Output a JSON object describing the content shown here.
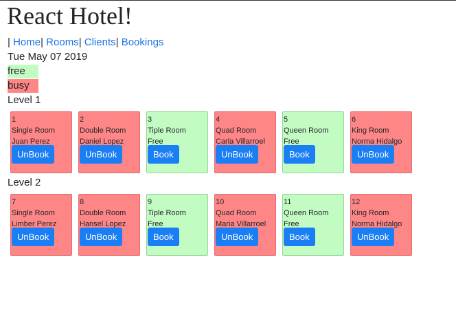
{
  "app": {
    "title": "React Hotel!"
  },
  "nav": {
    "leading_sep": "|",
    "items": [
      {
        "label": "Home",
        "sep": "|"
      },
      {
        "label": "Rooms",
        "sep": "|"
      },
      {
        "label": "Clients",
        "sep": "|"
      },
      {
        "label": "Bookings",
        "sep": ""
      }
    ]
  },
  "date": "Tue May 07 2019",
  "legend": {
    "free_label": "free",
    "busy_label": "busy",
    "free_color": "#c3fcc3",
    "busy_color": "#ff8686"
  },
  "levels": [
    {
      "label": "Level 1",
      "rooms": [
        {
          "number": "1",
          "type": "Single Room",
          "occupant": "Juan Perez",
          "status": "busy",
          "button": "UnBook"
        },
        {
          "number": "2",
          "type": "Double Room",
          "occupant": "Daniel Lopez",
          "status": "busy",
          "button": "UnBook"
        },
        {
          "number": "3",
          "type": "Tiple Room",
          "occupant": "Free",
          "status": "free",
          "button": "Book"
        },
        {
          "number": "4",
          "type": "Quad Room",
          "occupant": "Carla Villarroel",
          "status": "busy",
          "button": "UnBook"
        },
        {
          "number": "5",
          "type": "Queen Room",
          "occupant": "Free",
          "status": "free",
          "button": "Book"
        },
        {
          "number": "6",
          "type": "King Room",
          "occupant": "Norma Hidalgo",
          "status": "busy",
          "button": "UnBook"
        }
      ]
    },
    {
      "label": "Level 2",
      "rooms": [
        {
          "number": "7",
          "type": "Single Room",
          "occupant": "Limber Perez",
          "status": "busy",
          "button": "UnBook"
        },
        {
          "number": "8",
          "type": "Double Room",
          "occupant": "Hansel Lopez",
          "status": "busy",
          "button": "UnBook"
        },
        {
          "number": "9",
          "type": "Tiple Room",
          "occupant": "Free",
          "status": "free",
          "button": "Book"
        },
        {
          "number": "10",
          "type": "Quad Room",
          "occupant": "Maria Villarroel",
          "status": "busy",
          "button": "UnBook"
        },
        {
          "number": "11",
          "type": "Queen Room",
          "occupant": "Free",
          "status": "free",
          "button": "Book"
        },
        {
          "number": "12",
          "type": "King Room",
          "occupant": "Norma Hidalgo",
          "status": "busy",
          "button": "UnBook"
        }
      ]
    }
  ]
}
